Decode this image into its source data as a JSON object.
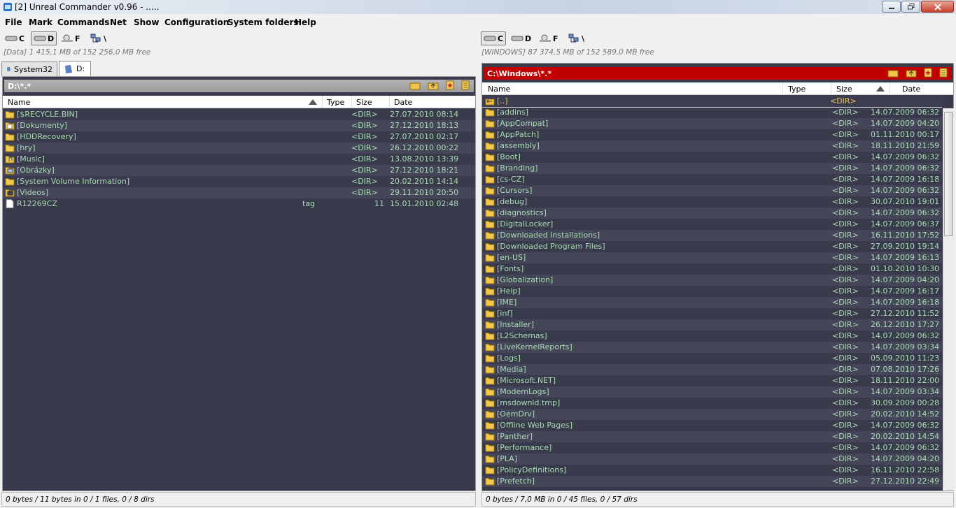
{
  "window": {
    "title": "[2] Unreal Commander v0.96 -        ....."
  },
  "menu": [
    "File",
    "Mark",
    "Commands",
    "Net",
    "Show",
    "Configuration",
    "System folders",
    "Help"
  ],
  "left": {
    "drives": [
      "C",
      "D",
      "F",
      "\\"
    ],
    "active_drive": "D",
    "drive_info": "[Data]  1 415,1 MB of  152 256,0 MB free",
    "tabs": [
      "System32",
      "D:"
    ],
    "path": "D:\\*.*",
    "columns": {
      "name": "Name",
      "type": "Type",
      "size": "Size",
      "date": "Date"
    },
    "rows": [
      {
        "icon": "folder-icon",
        "name": "[$RECYCLE.BIN]",
        "type": "",
        "size": "<DIR>",
        "date": "27.07.2010 08:14"
      },
      {
        "icon": "documents-folder-icon",
        "name": "[Dokumenty]",
        "type": "",
        "size": "<DIR>",
        "date": "27.12.2010 18:13"
      },
      {
        "icon": "folder-icon",
        "name": "[HDDRecovery]",
        "type": "",
        "size": "<DIR>",
        "date": "27.07.2010 02:17"
      },
      {
        "icon": "folder-icon",
        "name": "[hry]",
        "type": "",
        "size": "<DIR>",
        "date": "26.12.2010 00:22"
      },
      {
        "icon": "music-folder-icon",
        "name": "[Music]",
        "type": "",
        "size": "<DIR>",
        "date": "13.08.2010 13:39"
      },
      {
        "icon": "pictures-folder-icon",
        "name": "[Obrázky]",
        "type": "",
        "size": "<DIR>",
        "date": "27.12.2010 18:21"
      },
      {
        "icon": "folder-icon",
        "name": "[System Volume Information]",
        "type": "",
        "size": "<DIR>",
        "date": "20.02.2010 14:14"
      },
      {
        "icon": "videos-folder-icon",
        "name": "[Videos]",
        "type": "",
        "size": "<DIR>",
        "date": "29.11.2010 20:50"
      },
      {
        "icon": "file-icon",
        "name": "R12269CZ",
        "type": "tag",
        "size": "11",
        "date": "15.01.2010 02:48"
      }
    ],
    "status": "0 bytes / 11 bytes in 0 / 1 files, 0 / 8 dirs"
  },
  "right": {
    "drives": [
      "C",
      "D",
      "F",
      "\\"
    ],
    "active_drive": "C",
    "drive_info": "[WINDOWS]  87 374,5 MB of  152 589,0 MB free",
    "path": "C:\\Windows\\*.*",
    "columns": {
      "name": "Name",
      "type": "Type",
      "size": "Size",
      "date": "Date"
    },
    "updir": {
      "name": "[..]",
      "size": "<DIR>"
    },
    "rows": [
      {
        "name": "[addins]",
        "size": "<DIR>",
        "date": "14.07.2009 06:32"
      },
      {
        "name": "[AppCompat]",
        "size": "<DIR>",
        "date": "14.07.2009 04:20"
      },
      {
        "name": "[AppPatch]",
        "size": "<DIR>",
        "date": "01.11.2010 00:17"
      },
      {
        "name": "[assembly]",
        "size": "<DIR>",
        "date": "18.11.2010 21:59"
      },
      {
        "name": "[Boot]",
        "size": "<DIR>",
        "date": "14.07.2009 06:32"
      },
      {
        "name": "[Branding]",
        "size": "<DIR>",
        "date": "14.07.2009 06:32"
      },
      {
        "name": "[cs-CZ]",
        "size": "<DIR>",
        "date": "14.07.2009 16:18"
      },
      {
        "name": "[Cursors]",
        "size": "<DIR>",
        "date": "14.07.2009 06:32"
      },
      {
        "name": "[debug]",
        "size": "<DIR>",
        "date": "30.07.2010 19:01"
      },
      {
        "name": "[diagnostics]",
        "size": "<DIR>",
        "date": "14.07.2009 06:32"
      },
      {
        "name": "[DigitalLocker]",
        "size": "<DIR>",
        "date": "14.07.2009 06:37"
      },
      {
        "name": "[Downloaded Installations]",
        "size": "<DIR>",
        "date": "16.11.2010 17:52"
      },
      {
        "name": "[Downloaded Program Files]",
        "size": "<DIR>",
        "date": "27.09.2010 19:14"
      },
      {
        "name": "[en-US]",
        "size": "<DIR>",
        "date": "14.07.2009 16:13"
      },
      {
        "name": "[Fonts]",
        "size": "<DIR>",
        "date": "01.10.2010 10:30"
      },
      {
        "name": "[Globalization]",
        "size": "<DIR>",
        "date": "14.07.2009 04:20"
      },
      {
        "name": "[Help]",
        "size": "<DIR>",
        "date": "14.07.2009 16:17"
      },
      {
        "name": "[IME]",
        "size": "<DIR>",
        "date": "14.07.2009 16:18"
      },
      {
        "name": "[inf]",
        "size": "<DIR>",
        "date": "27.12.2010 11:52"
      },
      {
        "name": "[Installer]",
        "size": "<DIR>",
        "date": "26.12.2010 17:27"
      },
      {
        "name": "[L2Schemas]",
        "size": "<DIR>",
        "date": "14.07.2009 06:32"
      },
      {
        "name": "[LiveKernelReports]",
        "size": "<DIR>",
        "date": "14.07.2009 03:34"
      },
      {
        "name": "[Logs]",
        "size": "<DIR>",
        "date": "05.09.2010 11:23"
      },
      {
        "name": "[Media]",
        "size": "<DIR>",
        "date": "07.08.2010 17:26"
      },
      {
        "name": "[Microsoft.NET]",
        "size": "<DIR>",
        "date": "18.11.2010 22:00"
      },
      {
        "name": "[ModemLogs]",
        "size": "<DIR>",
        "date": "14.07.2009 03:34"
      },
      {
        "name": "[msdownld.tmp]",
        "size": "<DIR>",
        "date": "30.09.2009 00:28"
      },
      {
        "name": "[OemDrv]",
        "size": "<DIR>",
        "date": "20.02.2010 14:52"
      },
      {
        "name": "[Offline Web Pages]",
        "size": "<DIR>",
        "date": "14.07.2009 06:32"
      },
      {
        "name": "[Panther]",
        "size": "<DIR>",
        "date": "20.02.2010 14:54"
      },
      {
        "name": "[Performance]",
        "size": "<DIR>",
        "date": "14.07.2009 06:32"
      },
      {
        "name": "[PLA]",
        "size": "<DIR>",
        "date": "14.07.2009 04:20"
      },
      {
        "name": "[PolicyDefinitions]",
        "size": "<DIR>",
        "date": "16.11.2010 22:58"
      },
      {
        "name": "[Prefetch]",
        "size": "<DIR>",
        "date": "27.12.2010 22:49"
      }
    ],
    "status": "0 bytes / 7,0 MB in 0 / 45 files, 0 / 57 dirs"
  }
}
